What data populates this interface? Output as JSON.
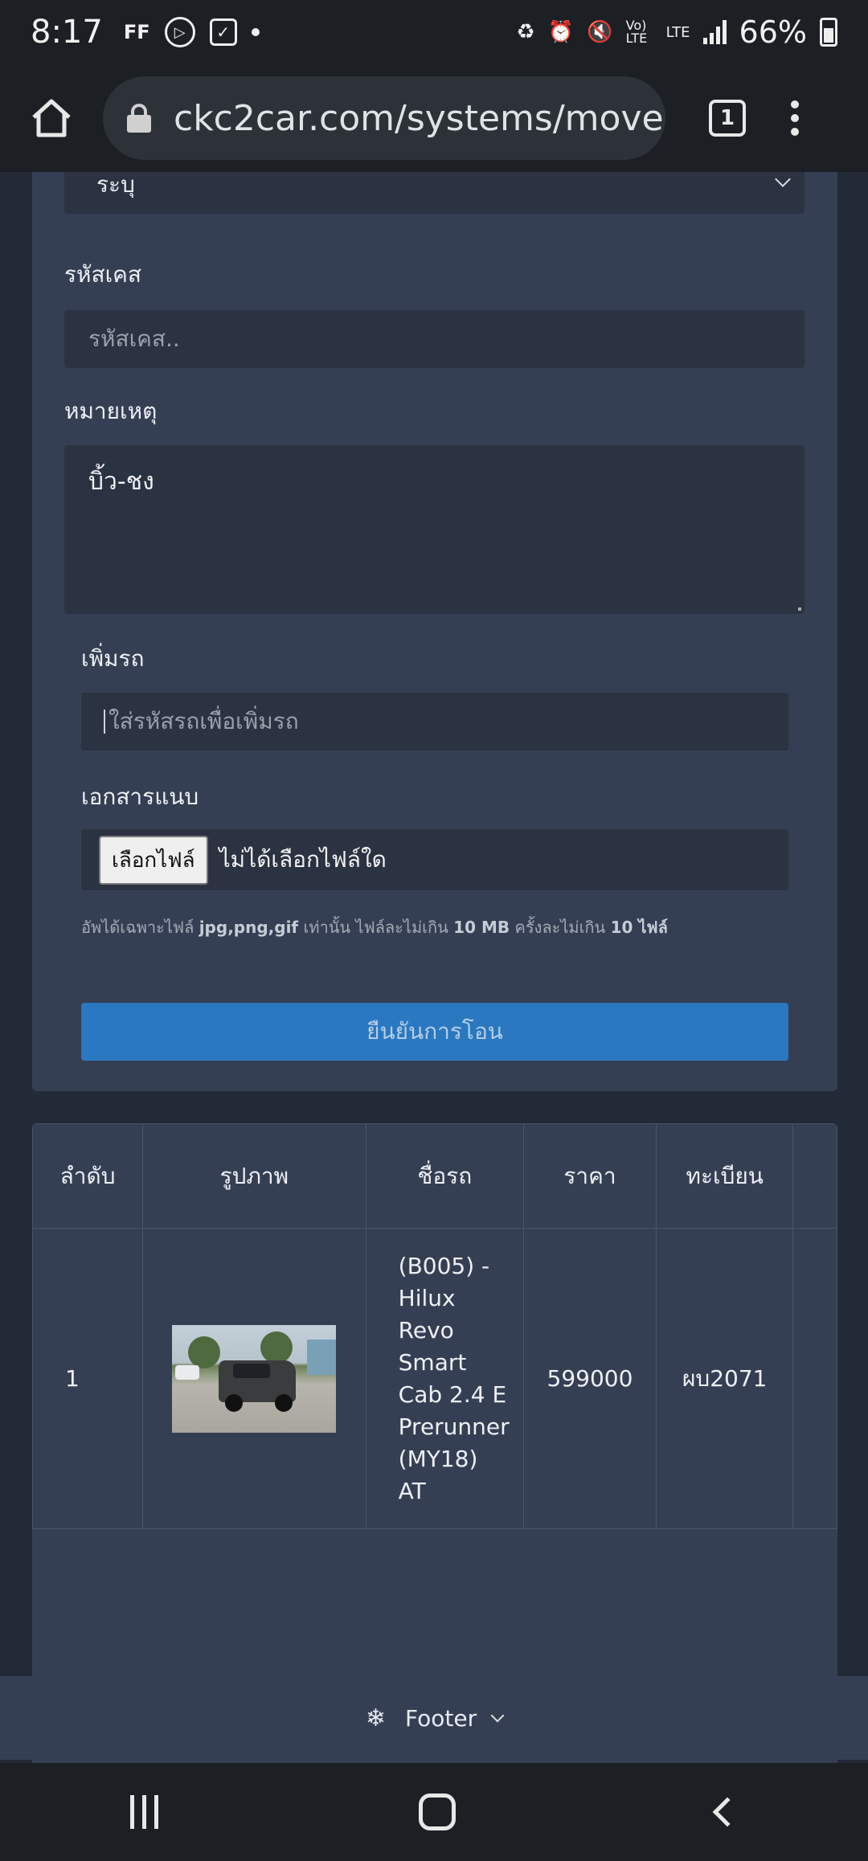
{
  "status_bar": {
    "time": "8:17",
    "battery": "66%",
    "lte_top": "Vo) LTE",
    "lte_bottom": "LTE"
  },
  "browser": {
    "url": "ckc2car.com/systems/move",
    "tab_count": "1"
  },
  "form": {
    "select_value": "ระบุ",
    "case_label": "รหัสเคส",
    "case_placeholder": "รหัสเคส..",
    "note_label": "หมายเหตุ",
    "note_value": "บิ้ว-ชง",
    "add_car_label": "เพิ่มรถ",
    "add_car_placeholder": "ใส่รหัสรถเพื่อเพิ่มรถ",
    "attachment_label": "เอกสารแนบ",
    "file_button": "เลือกไฟล์",
    "file_none": "ไม่ได้เลือกไฟล์ใด",
    "hint_prefix": "อัพได้เฉพาะไฟล์",
    "hint_types": "jpg,png,gif",
    "hint_middle": "เท่านั้น ไฟล์ละไม่เกิน",
    "hint_size": "10 MB",
    "hint_middle2": "ครั้งละไม่เกิน",
    "hint_count": "10 ไฟล์",
    "submit": "ยืนยันการโอน"
  },
  "table": {
    "headers": [
      "ลำดับ",
      "รูปภาพ",
      "ชื่อรถ",
      "ราคา",
      "ทะเบียน"
    ],
    "rows": [
      {
        "index": "1",
        "image": "car-photo",
        "name_lines": [
          "(B005) -",
          "Hilux",
          "Revo",
          "Smart",
          "Cab 2.4 E",
          "Prerunner",
          "(MY18)",
          "AT"
        ],
        "price": "599000",
        "registration": "ผบ2071"
      }
    ]
  },
  "footer": {
    "label": "Footer",
    "icon": "footer-icon"
  }
}
